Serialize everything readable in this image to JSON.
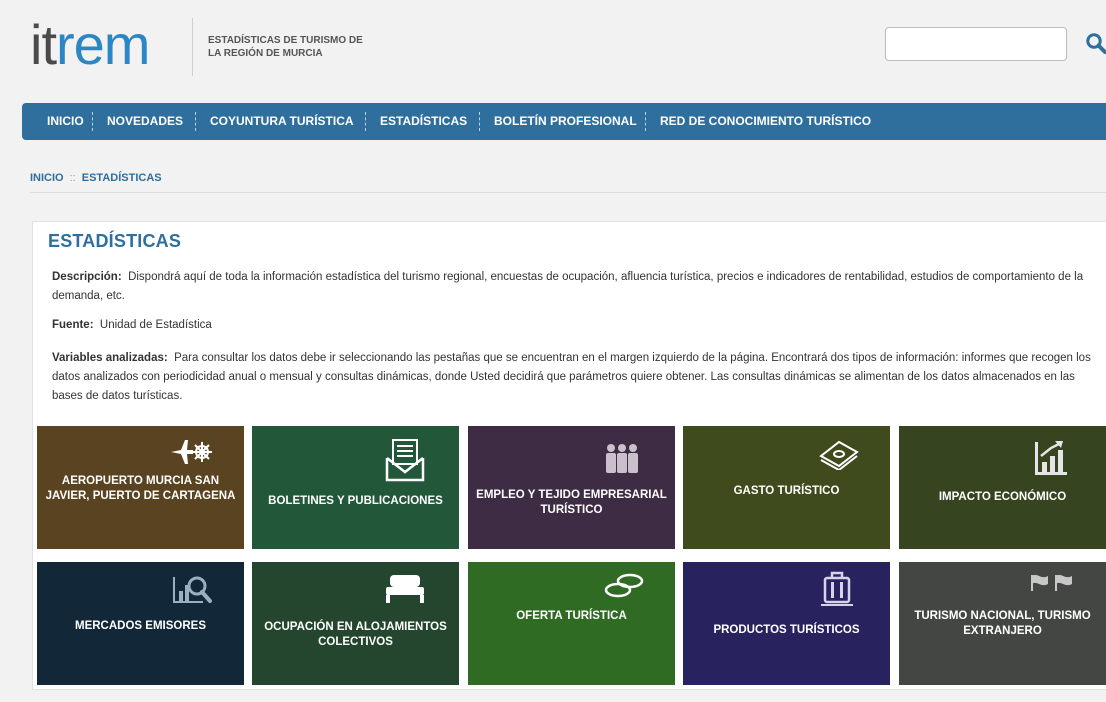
{
  "header": {
    "logo_it": "it",
    "logo_rem": "rem",
    "tagline_line1": "ESTADÍSTICAS DE TURISMO DE",
    "tagline_line2": "LA REGIÓN DE MURCIA",
    "search": {
      "value": "",
      "placeholder": ""
    }
  },
  "nav": {
    "items": [
      {
        "label": "INICIO"
      },
      {
        "label": "NOVEDADES"
      },
      {
        "label": "COYUNTURA TURÍSTICA"
      },
      {
        "label": "ESTADÍSTICAS"
      },
      {
        "label": "BOLETÍN PROFESIONAL"
      },
      {
        "label": "RED DE CONOCIMIENTO TURÍSTICO"
      }
    ]
  },
  "breadcrumb": {
    "home": "INICIO",
    "separator": "::",
    "current": "ESTADÍSTICAS"
  },
  "main": {
    "title": "ESTADÍSTICAS",
    "descripcion_label": "Descripción:",
    "descripcion_text": "Dispondrá aquí de toda la información estadística del turismo regional, encuestas de ocupación, afluencia turística, precios e indicadores de rentabilidad, estudios de comportamiento de la demanda, etc.",
    "fuente_label": "Fuente:",
    "fuente_text": "Unidad de Estadística",
    "variables_label": "Variables analizadas:",
    "variables_text": "Para consultar los datos debe ir seleccionando las pestañas que se encuentran en el margen izquierdo de la página. Encontrará dos tipos de información: informes que recogen los datos analizados con periodicidad anual o mensual y consultas dinámicas, donde Usted decidirá que parámetros quiere obtener. Las consultas dinámicas se alimentan de los datos almacenados en las bases de datos turísticas."
  },
  "tiles": [
    {
      "label": "AEROPUERTO MURCIA SAN JAVIER, PUERTO DE CARTAGENA",
      "color": "#5a4320",
      "icon": "plane-ship-wheel-icon"
    },
    {
      "label": "BOLETINES Y PUBLICACIONES",
      "color": "#22573a",
      "icon": "envelope-document-icon"
    },
    {
      "label": "EMPLEO Y TEJIDO EMPRESARIAL TURÍSTICO",
      "color": "#3e2c44",
      "icon": "people-group-icon"
    },
    {
      "label": "GASTO TURÍSTICO",
      "color": "#3f4a1d",
      "icon": "money-stack-icon"
    },
    {
      "label": "IMPACTO ECONÓMICO",
      "color": "#36441f",
      "icon": "growth-chart-icon"
    },
    {
      "label": "MERCADOS EMISORES",
      "color": "#122838",
      "icon": "chart-magnifier-icon"
    },
    {
      "label": "OCUPACIÓN EN ALOJAMIENTOS COLECTIVOS",
      "color": "#24452e",
      "icon": "bed-icon"
    },
    {
      "label": "OFERTA TURÍSTICA",
      "color": "#2f6b22",
      "icon": "coins-icon"
    },
    {
      "label": "PRODUCTOS TURÍSTICOS",
      "color": "#28235e",
      "icon": "luggage-icon"
    },
    {
      "label": "TURISMO NACIONAL, TURISMO EXTRANJERO",
      "color": "#444644",
      "icon": "flags-icon"
    }
  ]
}
